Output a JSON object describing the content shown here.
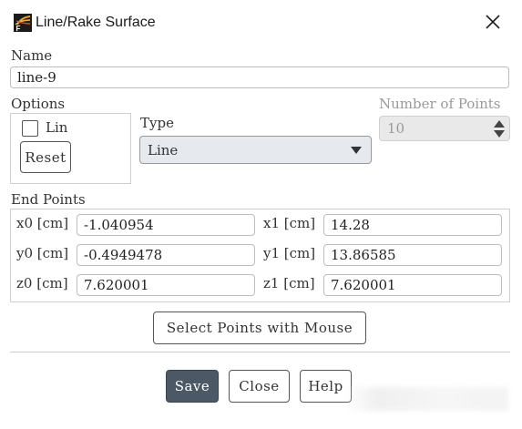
{
  "window": {
    "title": "Line/Rake Surface",
    "icon": "fluent-app-icon",
    "close_icon": "close-icon"
  },
  "name": {
    "label": "Name",
    "value": "line-9"
  },
  "options": {
    "label": "Options",
    "checkbox_label": "Lin",
    "checkbox_checked": false,
    "reset_label": "Reset"
  },
  "type": {
    "label": "Type",
    "selected": "Line"
  },
  "number_of_points": {
    "label": "Number of Points",
    "value": "10",
    "enabled": false
  },
  "end_points": {
    "label": "End Points",
    "rows": [
      {
        "left_label": "x0 [cm]",
        "left_value": "-1.040954",
        "right_label": "x1 [cm]",
        "right_value": "14.28"
      },
      {
        "left_label": "y0 [cm]",
        "left_value": "-0.4949478",
        "right_label": "y1 [cm]",
        "right_value": "13.86585"
      },
      {
        "left_label": "z0 [cm]",
        "left_value": "7.620001",
        "right_label": "z1 [cm]",
        "right_value": "7.620001"
      }
    ]
  },
  "select_points_label": "Select Points with Mouse",
  "footer": {
    "save_label": "Save",
    "close_label": "Close",
    "help_label": "Help"
  },
  "colors": {
    "primary_button": "#4b5966",
    "select_bg": "#e6e9ed",
    "border": "#bdbdbd"
  }
}
